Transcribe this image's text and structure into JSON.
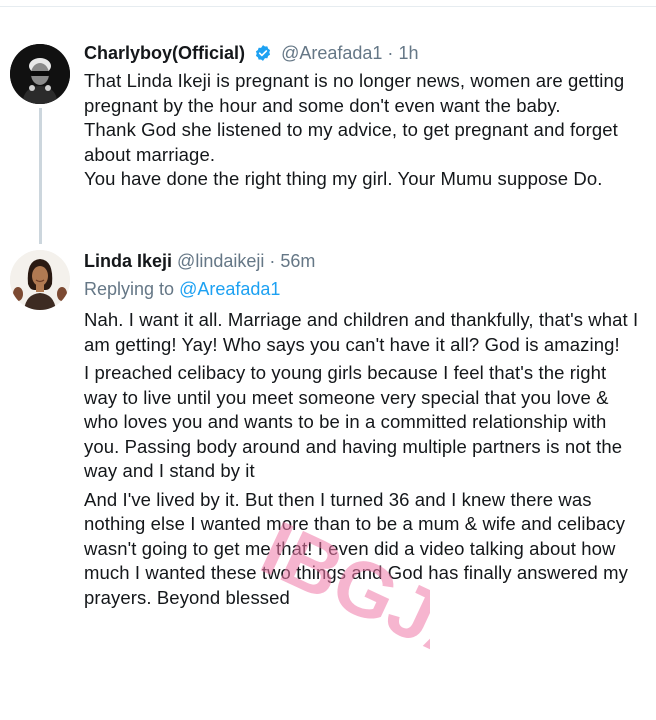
{
  "tweets": [
    {
      "display_name": "Charlyboy(Official)",
      "handle": "@Areafada1",
      "separator": "·",
      "time": "1h",
      "paragraphs": [
        "That Linda Ikeji is pregnant is no longer news, women are getting pregnant by the hour and some don't even want the baby.",
        "Thank God she listened to my advice, to get pregnant and forget about marriage.",
        "You have done the right thing my girl. Your Mumu suppose Do."
      ],
      "avatar_icon": "profile-photo-man-sunglasses",
      "verified_icon": "verified-badge-icon",
      "verified_color": "#1da1f2"
    },
    {
      "display_name": "Linda Ikeji",
      "handle": "@lindaikeji",
      "separator": "·",
      "time": "56m",
      "replying_prefix": "Replying to",
      "replying_to": "@Areafada1",
      "paragraphs": [
        "Nah. I want it all. Marriage and children and thankfully, that's what I am getting! Yay! Who says you can't have it all? God is amazing!",
        "I preached celibacy to young girls because I feel that's the right way to live until you meet someone very special that you love & who loves you and wants to be in a committed relationship with you. Passing body around and having multiple partners is not the way and I stand by it",
        "And I've lived by it. But then I turned 36 and I knew there was nothing else I wanted more than to be a mum & wife and celibacy wasn't going to get me that! I even did a video talking about how much I wanted these two things and God has finally answered my prayers. Beyond blessed"
      ],
      "avatar_icon": "profile-illustration-woman"
    }
  ],
  "watermark": {
    "text": "IBGJA",
    "color": "#f07aa8"
  },
  "colors": {
    "text": "#14171a",
    "secondary": "#657786",
    "link": "#1da1f2",
    "thread_line": "#ccd6dd"
  }
}
